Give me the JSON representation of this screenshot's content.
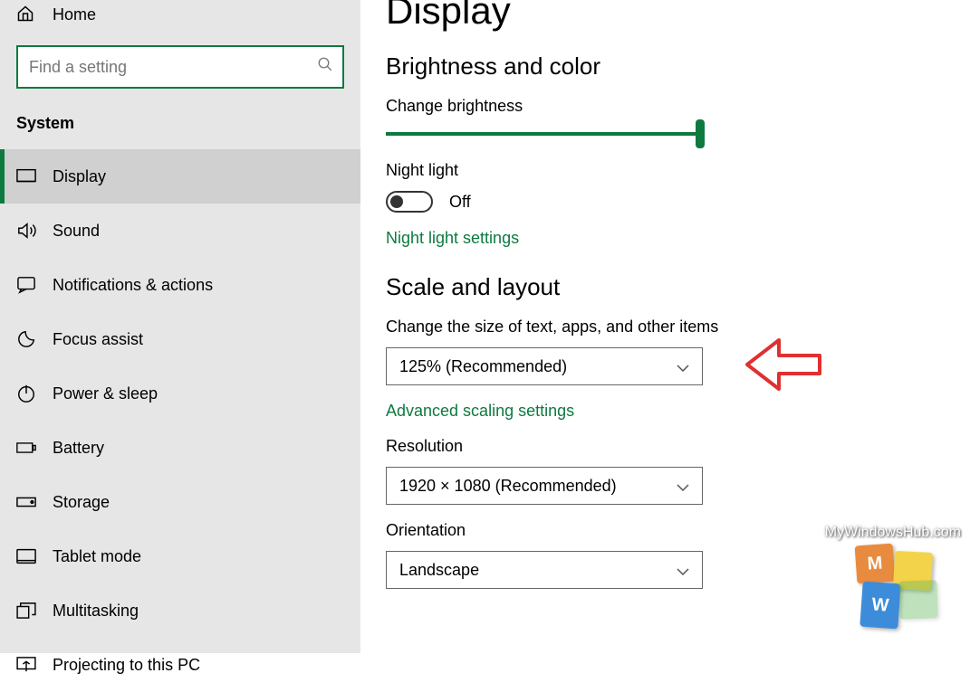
{
  "sidebar": {
    "home": "Home",
    "search_placeholder": "Find a setting",
    "heading": "System",
    "items": [
      {
        "label": "Display"
      },
      {
        "label": "Sound"
      },
      {
        "label": "Notifications & actions"
      },
      {
        "label": "Focus assist"
      },
      {
        "label": "Power & sleep"
      },
      {
        "label": "Battery"
      },
      {
        "label": "Storage"
      },
      {
        "label": "Tablet mode"
      },
      {
        "label": "Multitasking"
      },
      {
        "label": "Projecting to this PC"
      }
    ]
  },
  "main": {
    "title": "Display",
    "brightness_section": "Brightness and color",
    "brightness_label": "Change brightness",
    "nightlight_label": "Night light",
    "nightlight_state": "Off",
    "nightlight_link": "Night light settings",
    "scale_section": "Scale and layout",
    "scale_label": "Change the size of text, apps, and other items",
    "scale_value": "125% (Recommended)",
    "scale_link": "Advanced scaling settings",
    "resolution_label": "Resolution",
    "resolution_value": "1920 × 1080 (Recommended)",
    "orientation_label": "Orientation",
    "orientation_value": "Landscape"
  },
  "watermark": {
    "text": "MyWindowsHub.com",
    "m": "M",
    "w": "W"
  }
}
